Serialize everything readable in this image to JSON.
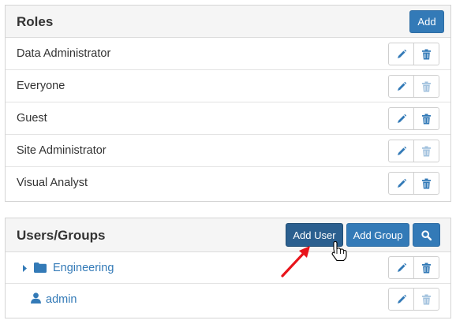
{
  "roles": {
    "title": "Roles",
    "add_label": "Add",
    "items": [
      {
        "label": "Data Administrator",
        "delete_enabled": true
      },
      {
        "label": "Everyone",
        "delete_enabled": false
      },
      {
        "label": "Guest",
        "delete_enabled": true
      },
      {
        "label": "Site Administrator",
        "delete_enabled": false
      },
      {
        "label": "Visual Analyst",
        "delete_enabled": true
      }
    ]
  },
  "users_groups": {
    "title": "Users/Groups",
    "add_user_label": "Add User",
    "add_group_label": "Add Group",
    "items": [
      {
        "label": "Engineering",
        "type": "group",
        "icon": "folder-icon",
        "delete_enabled": true
      },
      {
        "label": "admin",
        "type": "user",
        "icon": "user-icon",
        "delete_enabled": false
      }
    ]
  },
  "colors": {
    "primary": "#337ab7",
    "primary_active": "#2b5f8f",
    "link": "#337ab7",
    "annotation_arrow": "#e8141b"
  },
  "icons": {
    "edit": "pencil-icon",
    "delete": "trash-icon",
    "search": "search-icon",
    "expand": "caret-right-icon",
    "cursor": "hand-pointer-cursor"
  }
}
